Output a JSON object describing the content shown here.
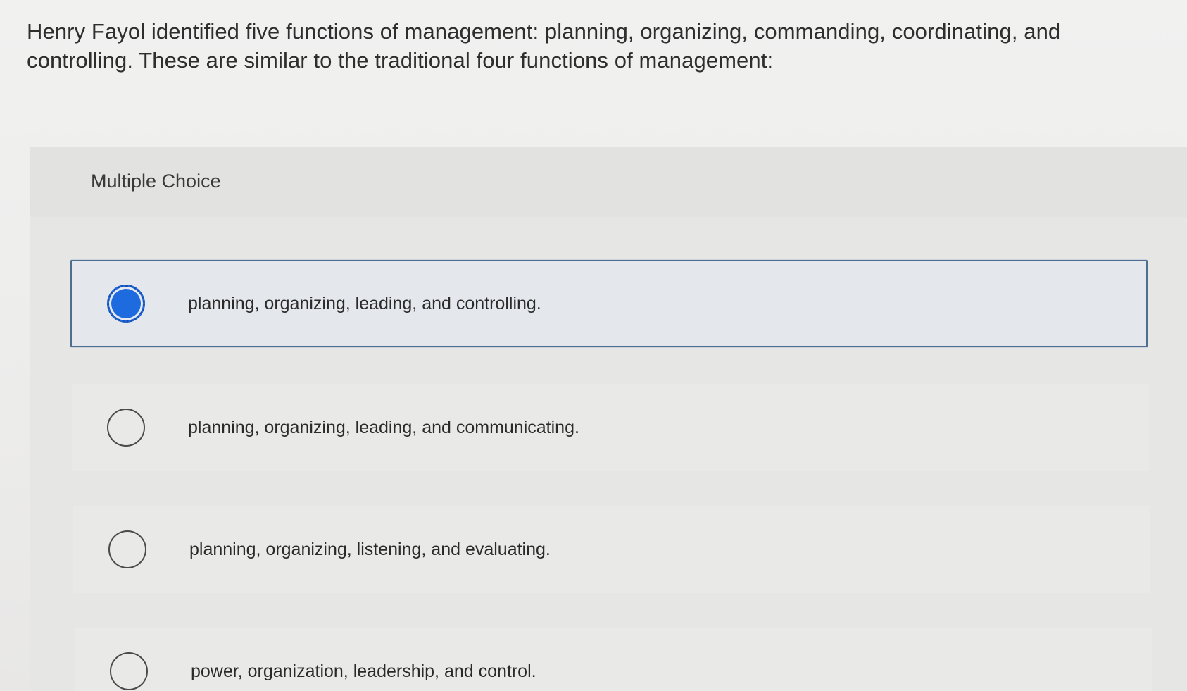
{
  "question": {
    "text": "Henry Fayol identified five functions of management: planning, organizing, commanding, coordinating, and controlling. These are similar to the traditional four functions of management:"
  },
  "multiple_choice": {
    "label": "Multiple Choice",
    "options": [
      {
        "label": "planning, organizing, leading, and controlling.",
        "selected": true
      },
      {
        "label": "planning, organizing, leading, and communicating.",
        "selected": false
      },
      {
        "label": "planning, organizing, listening, and evaluating.",
        "selected": false
      },
      {
        "label": "power, organization, leadership, and control.",
        "selected": false
      }
    ]
  },
  "colors": {
    "selected_radio": "#1e6be0",
    "selected_border": "#4d6e91"
  }
}
